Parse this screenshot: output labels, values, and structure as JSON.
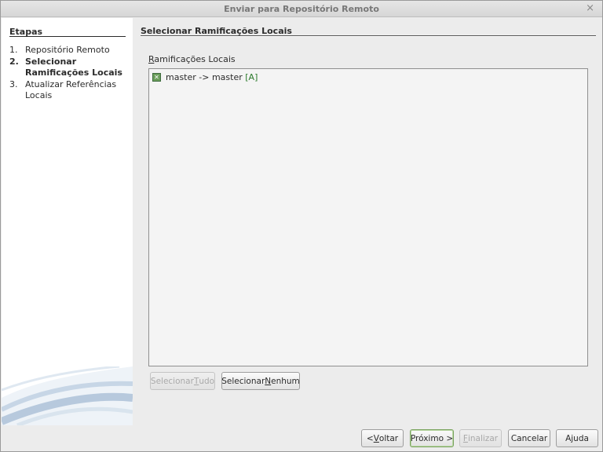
{
  "window": {
    "title": "Enviar para Repositório Remoto",
    "close_glyph": "×"
  },
  "steps": {
    "title": "Etapas",
    "items": [
      {
        "num": "1.",
        "label": "Repositório Remoto",
        "current": false
      },
      {
        "num": "2.",
        "label": "Selecionar Ramificações Locais",
        "current": true
      },
      {
        "num": "3.",
        "label": "Atualizar Referências Locais",
        "current": false
      }
    ]
  },
  "panel": {
    "title": "Selecionar Ramificações Locais",
    "list_label_mnemonic": "R",
    "list_label_rest": "amificações Locais",
    "items": [
      {
        "text": "master -> master ",
        "tag": "[A]",
        "checked": true
      }
    ]
  },
  "list_buttons": {
    "select_all_pre": "Selecionar ",
    "select_all_mn": "T",
    "select_all_post": "udo",
    "select_none_pre": "Selecionar ",
    "select_none_mn": "N",
    "select_none_post": "enhum"
  },
  "footer": {
    "back_pre": "< ",
    "back_mn": "V",
    "back_post": "oltar",
    "next": "Próximo >",
    "finish_mn": "F",
    "finish_post": "inalizar",
    "cancel": "Cancelar",
    "help": "Ajuda"
  },
  "colors": {
    "accent_green": "#6b9e5b",
    "tag_green": "#2a7a2a"
  }
}
